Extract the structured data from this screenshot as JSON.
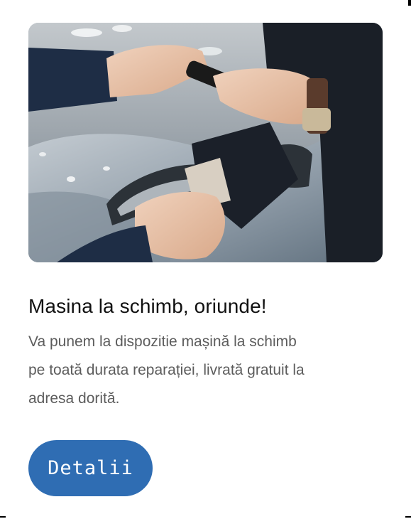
{
  "card": {
    "image_alt": "Predarea cheilor mașinii și strângere de mână",
    "title": "Masina la schimb, oriunde!",
    "description": "Va punem la dispozitie mașină la schimb pe toată durata reparației, livrată gratuit la adresa dorită.",
    "button_label": "Detalii"
  },
  "colors": {
    "button_bg": "#2f6db3",
    "title": "#111111",
    "description": "#5c5c5c"
  }
}
